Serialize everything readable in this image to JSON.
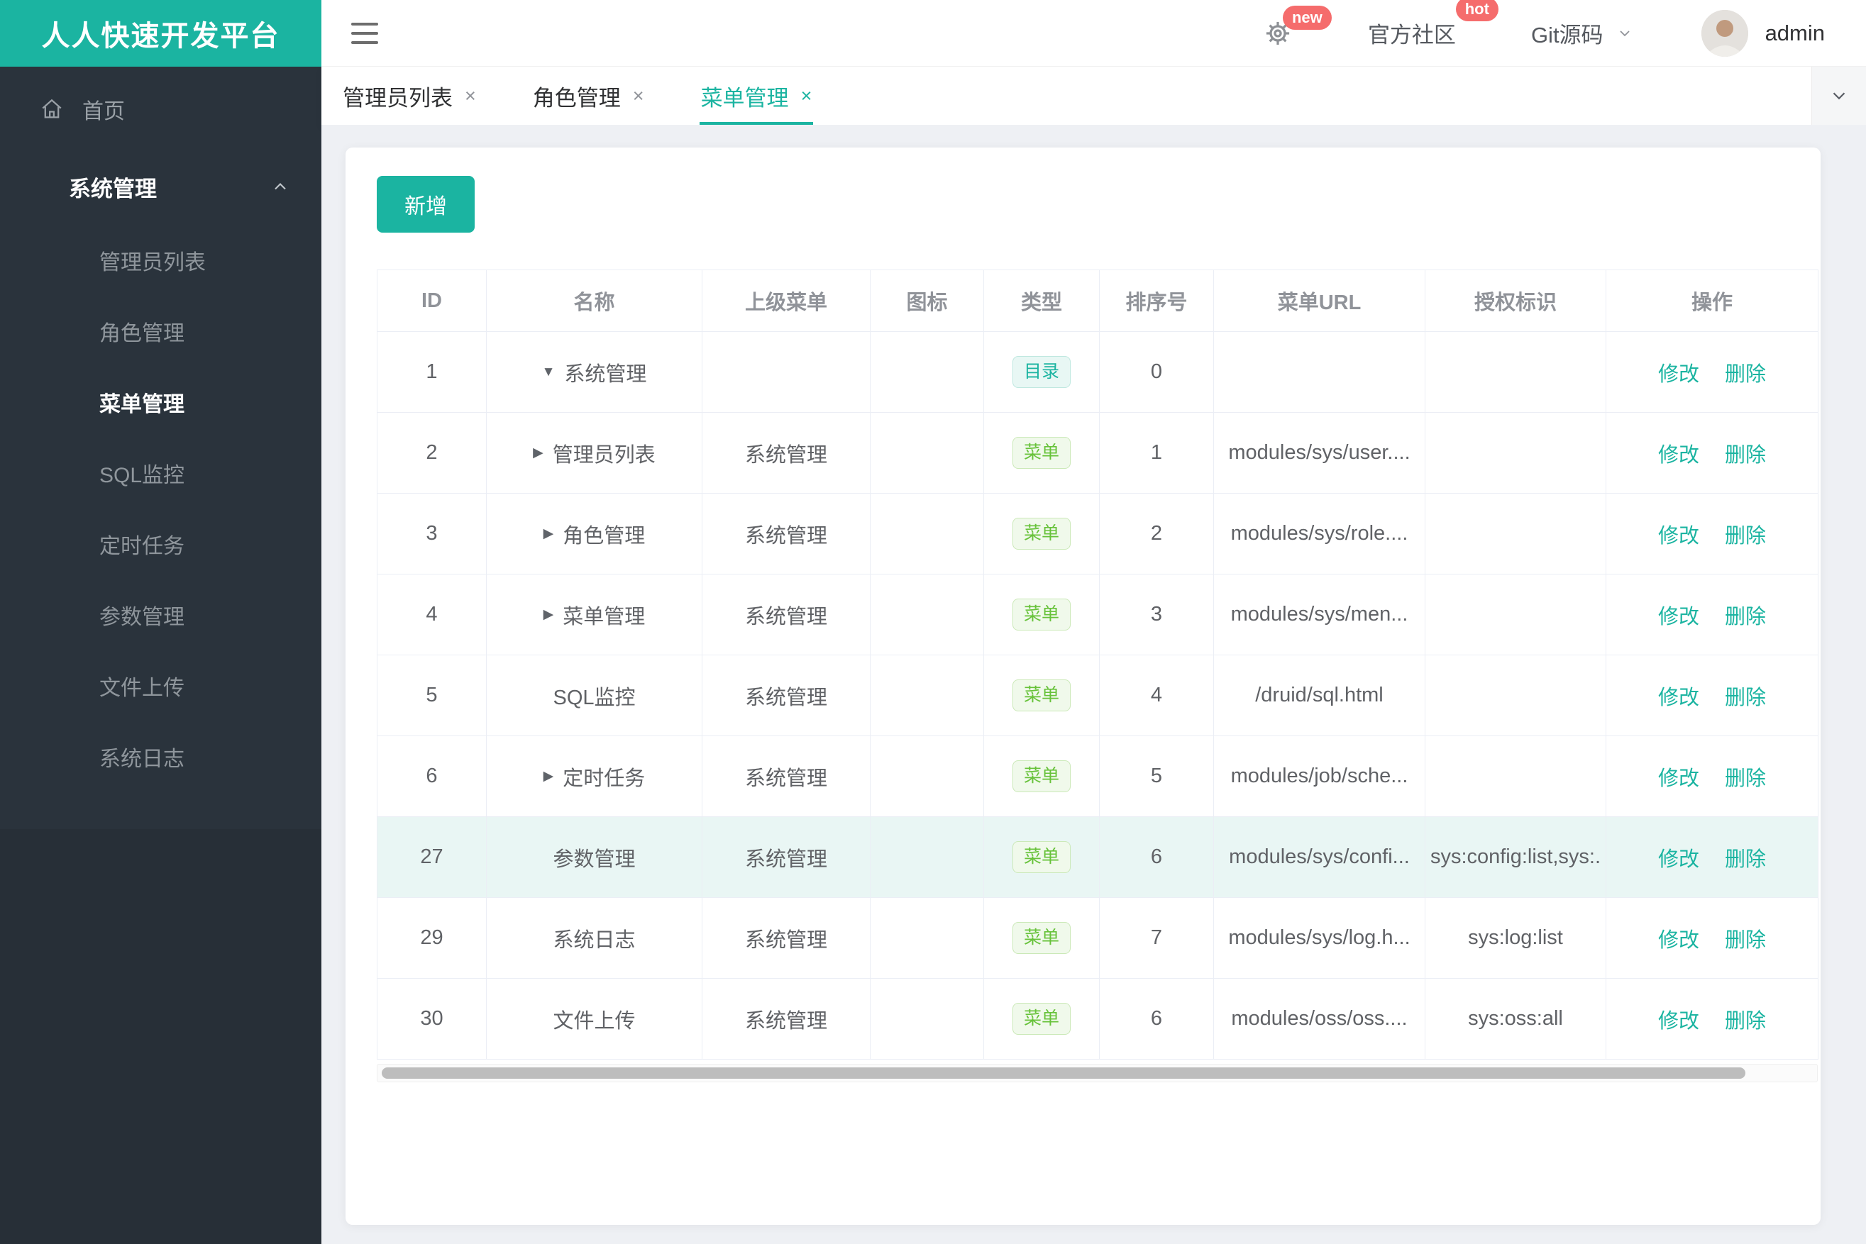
{
  "app": {
    "logo_title": "人人快速开发平台"
  },
  "header": {
    "settings_badge": "new",
    "community": {
      "label": "官方社区",
      "badge": "hot"
    },
    "git": {
      "label": "Git源码"
    },
    "user": {
      "name": "admin"
    }
  },
  "sidebar": {
    "home": {
      "label": "首页"
    },
    "group": {
      "label": "系统管理",
      "expanded": true,
      "items": [
        {
          "label": "管理员列表",
          "active": false
        },
        {
          "label": "角色管理",
          "active": false
        },
        {
          "label": "菜单管理",
          "active": true
        },
        {
          "label": "SQL监控",
          "active": false
        },
        {
          "label": "定时任务",
          "active": false
        },
        {
          "label": "参数管理",
          "active": false
        },
        {
          "label": "文件上传",
          "active": false
        },
        {
          "label": "系统日志",
          "active": false
        }
      ]
    }
  },
  "tabs": {
    "close_glyph": "×",
    "items": [
      {
        "label": "管理员列表",
        "active": false
      },
      {
        "label": "角色管理",
        "active": false
      },
      {
        "label": "菜单管理",
        "active": true
      }
    ]
  },
  "toolbar": {
    "add_label": "新增"
  },
  "table": {
    "columns": [
      "ID",
      "名称",
      "上级菜单",
      "图标",
      "类型",
      "排序号",
      "菜单URL",
      "授权标识",
      "操作"
    ],
    "type_labels": {
      "dir": "目录",
      "menu": "菜单"
    },
    "actions": {
      "edit": "修改",
      "delete": "删除"
    },
    "rows": [
      {
        "id": "1",
        "arrow": "down",
        "name": "系统管理",
        "parent": "",
        "icon": "",
        "type": "dir",
        "order": "0",
        "url": "",
        "perms": "",
        "highlight": false
      },
      {
        "id": "2",
        "arrow": "right",
        "name": "管理员列表",
        "parent": "系统管理",
        "icon": "",
        "type": "menu",
        "order": "1",
        "url": "modules/sys/user....",
        "perms": "",
        "highlight": false
      },
      {
        "id": "3",
        "arrow": "right",
        "name": "角色管理",
        "parent": "系统管理",
        "icon": "",
        "type": "menu",
        "order": "2",
        "url": "modules/sys/role....",
        "perms": "",
        "highlight": false
      },
      {
        "id": "4",
        "arrow": "right",
        "name": "菜单管理",
        "parent": "系统管理",
        "icon": "",
        "type": "menu",
        "order": "3",
        "url": "modules/sys/men...",
        "perms": "",
        "highlight": false
      },
      {
        "id": "5",
        "arrow": "",
        "name": "SQL监控",
        "parent": "系统管理",
        "icon": "",
        "type": "menu",
        "order": "4",
        "url": "/druid/sql.html",
        "perms": "",
        "highlight": false
      },
      {
        "id": "6",
        "arrow": "right",
        "name": "定时任务",
        "parent": "系统管理",
        "icon": "",
        "type": "menu",
        "order": "5",
        "url": "modules/job/sche...",
        "perms": "",
        "highlight": false
      },
      {
        "id": "27",
        "arrow": "",
        "name": "参数管理",
        "parent": "系统管理",
        "icon": "",
        "type": "menu",
        "order": "6",
        "url": "modules/sys/confi...",
        "perms": "sys:config:list,sys:.",
        "highlight": true
      },
      {
        "id": "29",
        "arrow": "",
        "name": "系统日志",
        "parent": "系统管理",
        "icon": "",
        "type": "menu",
        "order": "7",
        "url": "modules/sys/log.h...",
        "perms": "sys:log:list",
        "highlight": false
      },
      {
        "id": "30",
        "arrow": "",
        "name": "文件上传",
        "parent": "系统管理",
        "icon": "",
        "type": "menu",
        "order": "6",
        "url": "modules/oss/oss....",
        "perms": "sys:oss:all",
        "highlight": false
      }
    ]
  },
  "icons": {
    "expand_down": "▼",
    "expand_right": "▶"
  },
  "colors": {
    "accent": "#1bb4a1",
    "sidebar_bg": "#2a333c",
    "tag_menu_green": "#67c23a",
    "badge_red": "#f56c6c",
    "row_highlight": "#e9f6f4"
  }
}
